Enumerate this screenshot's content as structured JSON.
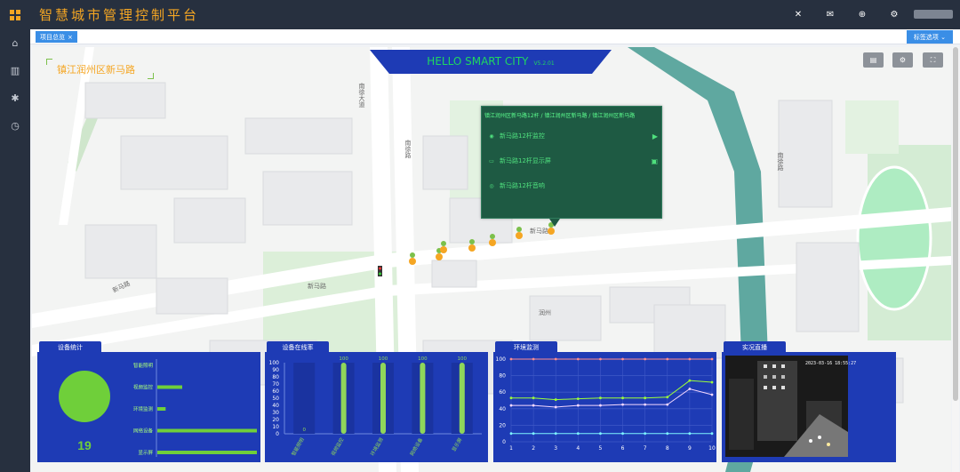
{
  "app": {
    "title": "智慧城市管理控制平台"
  },
  "header": {
    "icons": [
      "collapse-icon",
      "mail-icon",
      "globe-icon",
      "gear-icon"
    ]
  },
  "tabs": {
    "active": "项目总览",
    "close": "×",
    "menu": "标签选项 ⌄"
  },
  "banner": {
    "title": "HELLO SMART CITY",
    "version": "V5.2.01"
  },
  "location": "镇江润州区新马路",
  "map_buttons": [
    "layers-icon",
    "settings-icon",
    "fullscreen-icon"
  ],
  "map_labels": {
    "road1": "新马路",
    "road2": "新马路",
    "road3": "新马路",
    "road4": "南徐大道",
    "road5": "南徐路",
    "road6": "南徐路",
    "poi1": "润州"
  },
  "popup": {
    "title": "镇江润州区新马路12杆 / 镇江润州区新马路 / 镇江润州区新马路",
    "rows": [
      {
        "icon": "camera-icon",
        "label": "新马路12杆监控",
        "action": "play-icon"
      },
      {
        "icon": "screen-icon",
        "label": "新马路12杆显示屏",
        "action": "display-icon"
      },
      {
        "icon": "speaker-icon",
        "label": "新马路12杆音响",
        "action": ""
      }
    ]
  },
  "colors": {
    "panel": "#1e3bb5",
    "accent": "#f5a623",
    "green": "#6fcf3a",
    "popup": "#1e5a43"
  },
  "panels": {
    "device_stats": {
      "title": "设备统计",
      "total": "19"
    },
    "online_rate": {
      "title": "设备在线率"
    },
    "environment": {
      "title": "环境监测"
    },
    "live": {
      "title": "实况直播",
      "timestamp": "2023-03-16 18:55:27"
    }
  },
  "chart_data": [
    {
      "type": "bar",
      "orientation": "horizontal",
      "categories": [
        "智能照明",
        "视频监控",
        "环境监测",
        "网络设备",
        "显示屏"
      ],
      "values": [
        0,
        3,
        1,
        12,
        12
      ],
      "total": 19
    },
    {
      "type": "bar",
      "categories": [
        "智能照明",
        "视频监控",
        "环境监测",
        "网络设备",
        "显示屏"
      ],
      "values": [
        0,
        100,
        100,
        100,
        100
      ],
      "ylim": [
        0,
        100
      ],
      "yticks": [
        0,
        10,
        20,
        30,
        40,
        50,
        60,
        70,
        80,
        90,
        100
      ]
    },
    {
      "type": "line",
      "x": [
        1,
        2,
        3,
        4,
        5,
        6,
        7,
        8,
        9,
        10
      ],
      "ylim": [
        0,
        100
      ],
      "yticks": [
        0,
        20,
        40,
        60,
        80,
        100
      ],
      "series": [
        {
          "color": "#ff8e8e",
          "values": [
            100,
            100,
            100,
            100,
            100,
            100,
            100,
            100,
            100,
            100
          ]
        },
        {
          "color": "#9dff3a",
          "values": [
            53,
            53,
            51,
            52,
            53,
            53,
            53,
            54,
            74,
            72
          ]
        },
        {
          "color": "#f5d8ff",
          "values": [
            44,
            44,
            42,
            44,
            44,
            45,
            45,
            45,
            64,
            57
          ]
        },
        {
          "color": "#7df5ff",
          "values": [
            10,
            10,
            10,
            10,
            10,
            10,
            10,
            10,
            10,
            10
          ]
        }
      ]
    }
  ]
}
